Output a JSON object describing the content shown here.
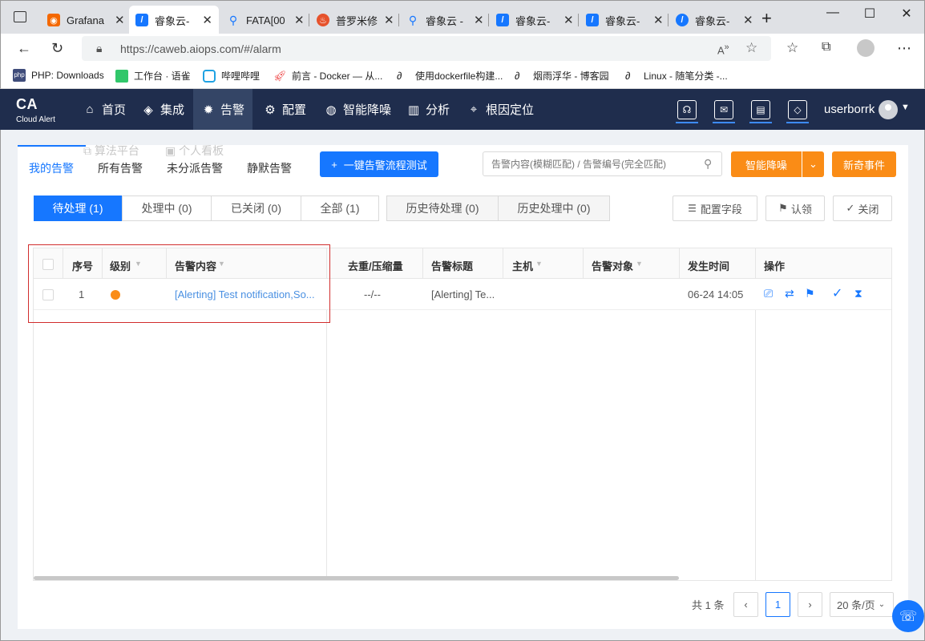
{
  "browser": {
    "tabs": [
      {
        "title": "Grafana",
        "icon": "grafana-icon"
      },
      {
        "title": "睿象云-",
        "icon": "ca-icon"
      },
      {
        "title": "FATA[00",
        "icon": "search-icon"
      },
      {
        "title": "普罗米修",
        "icon": "prometheus-icon"
      },
      {
        "title": "睿象云 -",
        "icon": "search-icon"
      },
      {
        "title": "睿象云-",
        "icon": "ca-icon"
      },
      {
        "title": "睿象云-",
        "icon": "ca-icon"
      },
      {
        "title": "睿象云-",
        "icon": "ca-icon"
      }
    ],
    "url": "https://caweb.aiops.com/#/alarm",
    "bookmarks": [
      "PHP: Downloads",
      "工作台 · 语雀",
      "哔哩哔哩",
      "前言 - Docker — 从...",
      "使用dockerfile构建...",
      "烟雨浮华 - 博客园",
      "Linux - 随笔分类 -..."
    ]
  },
  "app": {
    "logo_title": "CA",
    "logo_subtitle": "Cloud Alert",
    "nav": [
      {
        "label": "首页",
        "icon": "home-icon"
      },
      {
        "label": "集成",
        "icon": "layers-icon"
      },
      {
        "label": "告警",
        "icon": "alarm-icon"
      },
      {
        "label": "配置",
        "icon": "gear-icon"
      },
      {
        "label": "智能降噪",
        "icon": "noise-icon"
      },
      {
        "label": "分析",
        "icon": "chart-icon"
      },
      {
        "label": "根因定位",
        "icon": "target-icon"
      }
    ],
    "active_nav": "告警",
    "username": "userborrk"
  },
  "alarm": {
    "subtabs": [
      "我的告警",
      "所有告警",
      "未分派告警",
      "静默告警"
    ],
    "ghost_tabs": [
      "算法平台",
      "个人看板"
    ],
    "test_button": "一键告警流程测试",
    "search_placeholder": "告警内容(模糊匹配) / 告警编号(完全匹配)",
    "noise_button": "智能降噪",
    "new_event_button": "新奇事件",
    "status_tabs": [
      "待处理 (1)",
      "处理中 (0)",
      "已关闭 (0)",
      "全部 (1)"
    ],
    "history_tabs": [
      "历史待处理 (0)",
      "历史处理中 (0)"
    ],
    "config_fields_button": "配置字段",
    "claim_button": "认领",
    "close_button": "关闭",
    "columns": [
      "序号",
      "级别",
      "告警内容",
      "去重/压缩量",
      "告警标题",
      "主机",
      "告警对象",
      "发生时间",
      "操作"
    ],
    "rows": [
      {
        "index": "1",
        "level_color": "#fa8c16",
        "content": "[Alerting] Test notification,So...",
        "dedup": "--/--",
        "title": "[Alerting] Te...",
        "host": "",
        "object": "",
        "time": "06-24 14:05"
      }
    ],
    "pagination": {
      "total": "共 1 条",
      "current_page": "1",
      "page_size": "20 条/页"
    }
  }
}
